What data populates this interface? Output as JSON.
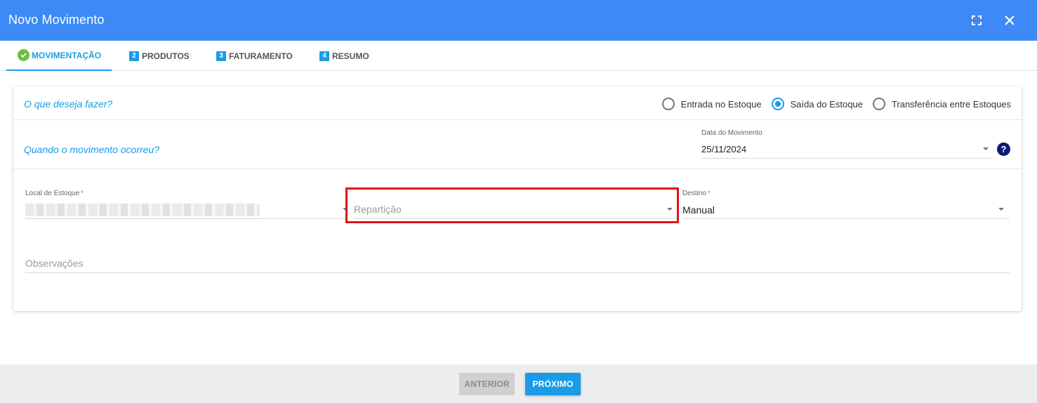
{
  "window": {
    "title": "Novo Movimento",
    "maximize_icon": "maximize-icon",
    "close_icon": "close-icon"
  },
  "tabs": [
    {
      "label": "MOVIMENTAÇÃO",
      "badge": "",
      "done": true
    },
    {
      "label": "PRODUTOS",
      "badge": "2",
      "done": false
    },
    {
      "label": "FATURAMENTO",
      "badge": "3",
      "done": false
    },
    {
      "label": "RESUMO",
      "badge": "4",
      "done": false
    }
  ],
  "form": {
    "question_action": "O que deseja fazer?",
    "options": [
      {
        "label": "Entrada no Estoque",
        "selected": false
      },
      {
        "label": "Saída do Estoque",
        "selected": true
      },
      {
        "label": "Transferência entre Estoques",
        "selected": false
      }
    ],
    "question_when": "Quando o movimento ocorreu?",
    "date_label": "Data do Movimento",
    "date_value": "25/11/2024",
    "help_symbol": "?",
    "local_label": "Local de Estoque",
    "required_mark": "*",
    "reparticao_placeholder": "Repartição",
    "destino_label": "Destino",
    "destino_value": "Manual",
    "observacoes_placeholder": "Observações"
  },
  "footer": {
    "prev_label": "ANTERIOR",
    "next_label": "PRÓXIMO"
  },
  "colors": {
    "header": "#3d8af7",
    "accent": "#1a9be8",
    "highlight": "#e0141b"
  }
}
